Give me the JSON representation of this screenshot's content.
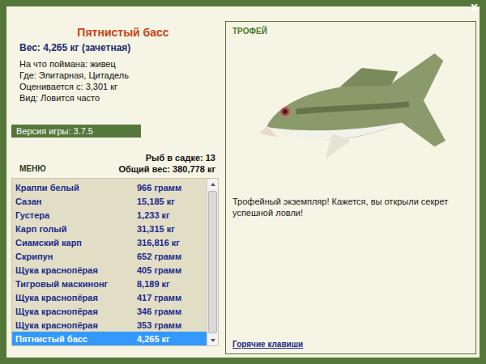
{
  "window": {
    "close": "x"
  },
  "fish_card": {
    "name": "Пятнистый басс",
    "weight": "Вес: 4,265 кг (зачетная)",
    "details": [
      "На что поймана: живец",
      "Где: Элитарная, Цитадель",
      "Оценивается с: 3,301 кг",
      "Вид: Ловится часто"
    ]
  },
  "version": "Версия игры: 3.7.5",
  "menu": "МЕНЮ",
  "keepnet": {
    "count": "Рыб в садке: 13",
    "total": "Общий вес: 380,778 кг"
  },
  "catch_list": [
    {
      "name": "Краппи белый",
      "weight": "966 грамм",
      "selected": false
    },
    {
      "name": "Сазан",
      "weight": "15,185 кг",
      "selected": false
    },
    {
      "name": "Густера",
      "weight": "1,233 кг",
      "selected": false
    },
    {
      "name": "Карп голый",
      "weight": "31,315 кг",
      "selected": false
    },
    {
      "name": "Сиамский карп",
      "weight": "316,816 кг",
      "selected": false
    },
    {
      "name": "Скрипун",
      "weight": "652 грамм",
      "selected": false
    },
    {
      "name": "Щука краснопёрая",
      "weight": "405 грамм",
      "selected": false
    },
    {
      "name": "Тигровый маскинонг",
      "weight": "8,189 кг",
      "selected": false
    },
    {
      "name": "Щука краснопёрая",
      "weight": "417 грамм",
      "selected": false
    },
    {
      "name": "Щука краснопёрая",
      "weight": "346 грамм",
      "selected": false
    },
    {
      "name": "Щука краснопёрая",
      "weight": "353 грамм",
      "selected": false
    },
    {
      "name": "Пятнистый басс",
      "weight": "4,265 кг",
      "selected": true
    }
  ],
  "trophy": {
    "label": "ТРОФЕЙ",
    "message": "Трофейный экземпляр! Кажется, вы открыли секрет успешной ловли!",
    "hotkeys_link": "Горячие клавиши"
  }
}
